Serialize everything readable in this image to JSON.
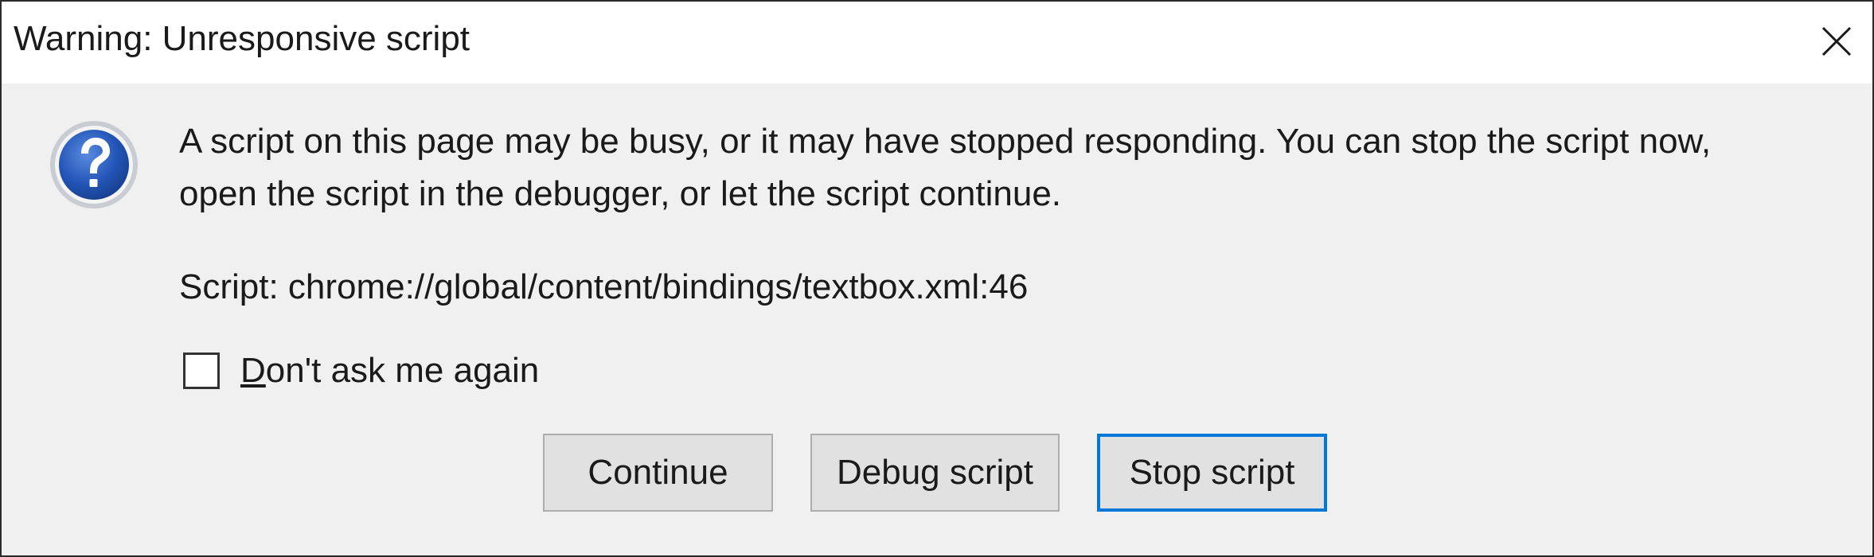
{
  "window": {
    "title": "Warning: Unresponsive script"
  },
  "dialog": {
    "message_line1": "A script on this page may be busy, or it may have stopped responding. You can stop the script now,",
    "message_line2": "open the script in the debugger, or let the script continue.",
    "script_label": "Script: chrome://global/content/bindings/textbox.xml:46",
    "checkbox": {
      "access_key": "D",
      "label_rest": "on't ask me again",
      "checked": false
    }
  },
  "buttons": {
    "continue_label": "Continue",
    "debug_label": "Debug script",
    "stop_label": "Stop script"
  },
  "icons": {
    "close": "close-icon",
    "question": "question-icon"
  },
  "colors": {
    "focus_accent": "#0078d7",
    "icon_blue": "#1f4fa8"
  }
}
